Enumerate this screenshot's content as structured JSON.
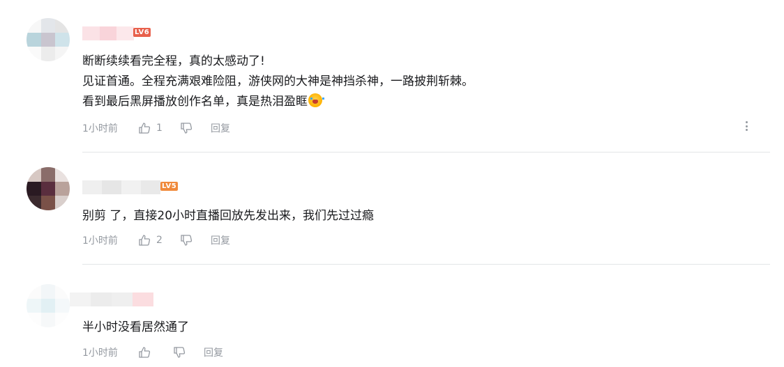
{
  "colors": {
    "text": "#18191c",
    "meta": "#9499a0",
    "divider": "#e3e5e7",
    "level_badge": "#e8604c",
    "level_badge_5": "#f08a3c"
  },
  "comments": [
    {
      "level": "LV6",
      "lines": [
        "断断续续看完全程，真的太感动了!",
        "见证首通。全程充满艰难险阻，游侠网的大神是神挡杀神，一路披荆斩棘。",
        "看到最后黑屏播放创作名单，真是热泪盈眶"
      ],
      "emoji": "crying-emoji",
      "time": "1小时前",
      "likes": "1",
      "reply_label": "回复"
    },
    {
      "level": "LV5",
      "lines": [
        "别剪 了，直接20小时直播回放先发出来，我们先过过瘾"
      ],
      "time": "1小时前",
      "likes": "2",
      "reply_label": "回复"
    },
    {
      "level": "",
      "lines": [
        "半小时没看居然通了"
      ],
      "time": "1小时前",
      "likes": "",
      "reply_label": "回复"
    }
  ]
}
